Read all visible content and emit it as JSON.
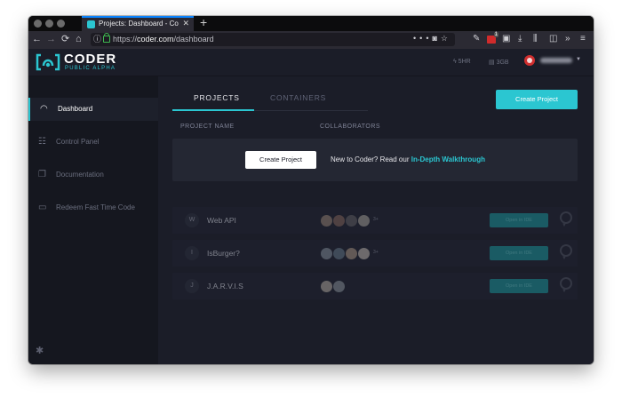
{
  "browser": {
    "tab_title": "Projects: Dashboard - Coder",
    "url_prefix": "https://",
    "url_host": "coder.com",
    "url_path": "/dashboard",
    "toolbar_badge": "1"
  },
  "app": {
    "brand": "CODER",
    "brand_sub": "PUBLIC ALPHA",
    "stats": {
      "cpu": "5HR",
      "ram": "3GB"
    },
    "colors": {
      "accent": "#2bc6d1",
      "bg": "#1b1d28",
      "sidebar": "#15171f"
    }
  },
  "sidebar": {
    "items": [
      {
        "label": "Dashboard",
        "icon": "speedometer-icon"
      },
      {
        "label": "Control Panel",
        "icon": "sliders-icon"
      },
      {
        "label": "Documentation",
        "icon": "documents-icon"
      },
      {
        "label": "Redeem Fast Time Code",
        "icon": "ticket-icon"
      }
    ]
  },
  "main": {
    "tabs": [
      "PROJECTS",
      "CONTAINERS"
    ],
    "create_button": "Create Project",
    "columns": [
      "PROJECT NAME",
      "COLLABORATORS"
    ],
    "banner": {
      "button": "Create Project",
      "text": "New to Coder? Read our ",
      "link": "In-Depth Walkthrough"
    },
    "projects": [
      {
        "letter": "W",
        "name": "Web API",
        "more": "3+",
        "action": "Open in IDE"
      },
      {
        "letter": "I",
        "name": "IsBurger?",
        "more": "3+",
        "action": "Open in IDE"
      },
      {
        "letter": "J",
        "name": "J.A.R.V.I.S",
        "more": "",
        "action": "Open in IDE"
      }
    ]
  }
}
